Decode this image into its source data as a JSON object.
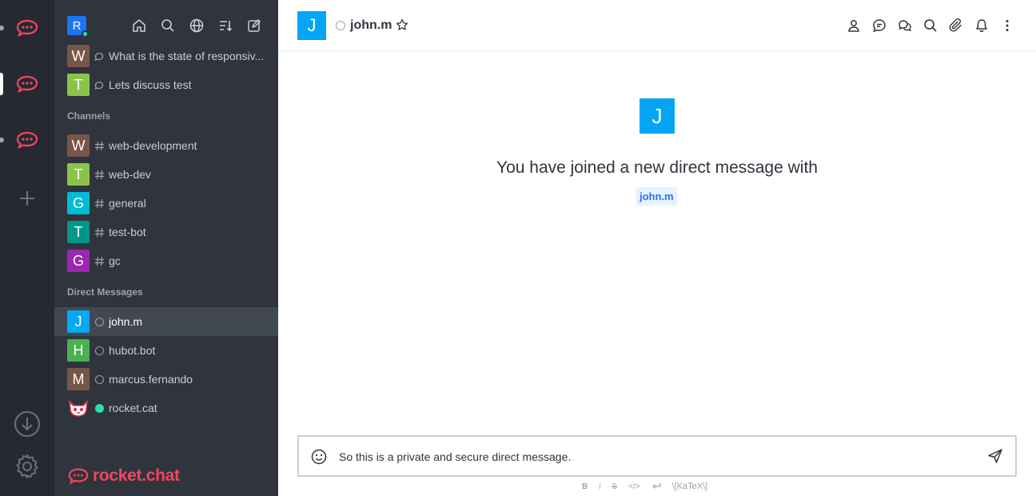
{
  "servers": [
    {
      "name": "rocket-chat-server-1",
      "active": false
    },
    {
      "name": "rocket-chat-server-2",
      "active": true
    },
    {
      "name": "rocket-chat-server-3",
      "active": false
    }
  ],
  "sidebar": {
    "user_initial": "R",
    "discussions": [
      {
        "initial": "W",
        "color": "#795548",
        "label": "What is the state of responsiv..."
      },
      {
        "initial": "T",
        "color": "#8bc34a",
        "label": "Lets discuss test"
      }
    ],
    "channels_title": "Channels",
    "channels": [
      {
        "initial": "W",
        "color": "#795548",
        "label": "web-development"
      },
      {
        "initial": "T",
        "color": "#8bc34a",
        "label": "web-dev"
      },
      {
        "initial": "G",
        "color": "#00bcd4",
        "label": "general"
      },
      {
        "initial": "T",
        "color": "#009688",
        "label": "test-bot"
      },
      {
        "initial": "G",
        "color": "#9c27b0",
        "label": "gc"
      }
    ],
    "dm_title": "Direct Messages",
    "direct_messages": [
      {
        "initial": "J",
        "color": "#03a9f4",
        "label": "john.m",
        "status": "offline",
        "active": true
      },
      {
        "initial": "H",
        "color": "#4caf50",
        "label": "hubot.bot",
        "status": "offline",
        "active": false
      },
      {
        "initial": "M",
        "color": "#795548",
        "label": "marcus.fernando",
        "status": "offline",
        "active": false
      },
      {
        "initial": "",
        "color": "#ffffff",
        "label": "rocket.cat",
        "status": "online",
        "active": false
      }
    ],
    "brand": "rocket.chat"
  },
  "room": {
    "initial": "J",
    "name": "john.m",
    "welcome_text": "You have joined a new direct message with",
    "welcome_user": "john.m"
  },
  "composer": {
    "value": "So this is a private and secure direct message."
  },
  "format_bar": {
    "bold": "B",
    "italic": "i",
    "strike": "S",
    "code": "</>",
    "katex": "\\[KaTeX\\]"
  },
  "colors": {
    "rail_bg": "#262931",
    "sidebar_bg": "#2f343d",
    "brand_red": "#f5455c",
    "room_avatar": "#05a5f5",
    "online": "#2de0a5"
  }
}
